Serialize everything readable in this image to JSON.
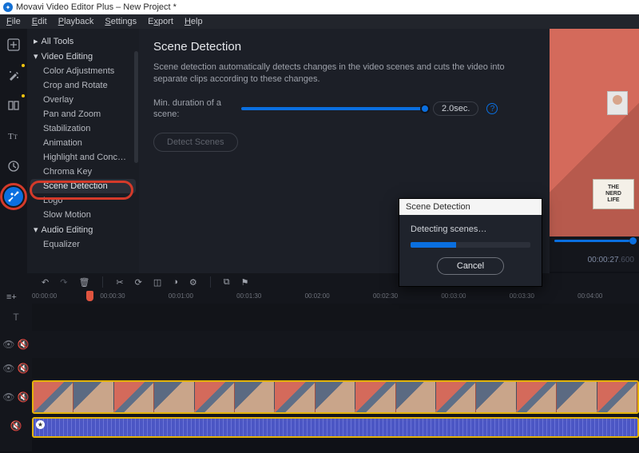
{
  "window": {
    "title": "Movavi Video Editor Plus – New Project *"
  },
  "menu": {
    "file": "File",
    "edit": "Edit",
    "playback": "Playback",
    "settings": "Settings",
    "export": "Export",
    "help": "Help"
  },
  "rail": {
    "icons": [
      "plus",
      "wand",
      "frame",
      "text",
      "clock",
      "tools"
    ],
    "selected": "tools"
  },
  "sidebar": {
    "all_tools": "All Tools",
    "video_editing": "Video Editing",
    "items": [
      "Color Adjustments",
      "Crop and Rotate",
      "Overlay",
      "Pan and Zoom",
      "Stabilization",
      "Animation",
      "Highlight and Conc…",
      "Chroma Key",
      "Scene Detection",
      "Logo",
      "Slow Motion"
    ],
    "audio_editing": "Audio Editing",
    "audio_items": [
      "Equalizer"
    ],
    "selected_index": 8
  },
  "panel": {
    "title": "Scene Detection",
    "description": "Scene detection automatically detects changes in the video scenes and cuts the video into separate clips according to these changes.",
    "min_duration_label": "Min. duration of a scene:",
    "min_duration_value": "2.0sec.",
    "detect_button": "Detect Scenes"
  },
  "dialog": {
    "title": "Scene Detection",
    "message": "Detecting scenes…",
    "progress_percent": 38,
    "cancel": "Cancel"
  },
  "preview": {
    "sign_text": "THE\nNERD\nLIFE",
    "timecode_main": "00:00:27",
    "timecode_ms": ".600"
  },
  "timeline": {
    "ticks": [
      "00:00:00",
      "00:00:30",
      "00:01:00",
      "00:01:30",
      "00:02:00",
      "00:02:30",
      "00:03:00",
      "00:03:30",
      "00:04:00"
    ],
    "playhead_position_pct": 9.5
  }
}
